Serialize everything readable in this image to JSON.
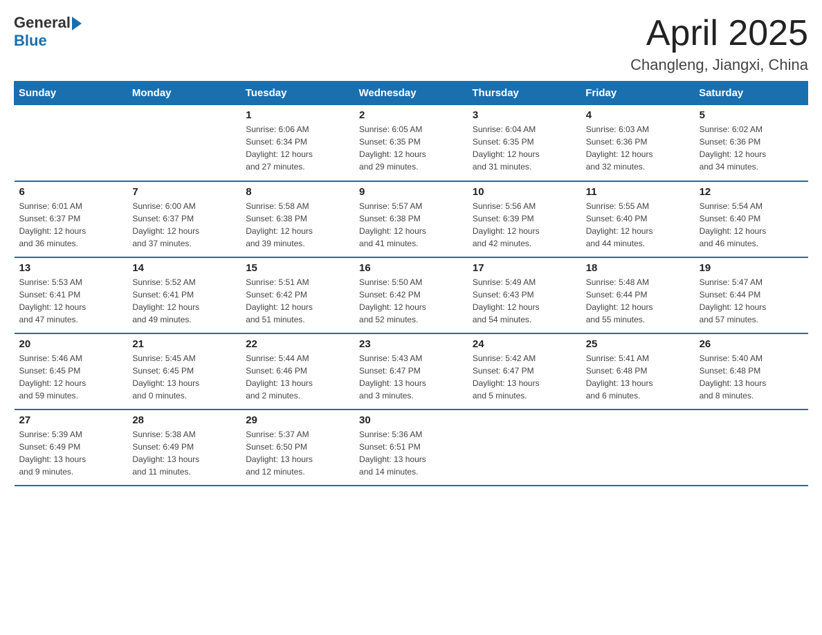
{
  "logo": {
    "text_general": "General",
    "text_blue": "Blue"
  },
  "header": {
    "month": "April 2025",
    "location": "Changleng, Jiangxi, China"
  },
  "weekdays": [
    "Sunday",
    "Monday",
    "Tuesday",
    "Wednesday",
    "Thursday",
    "Friday",
    "Saturday"
  ],
  "weeks": [
    [
      {
        "day": "",
        "info": ""
      },
      {
        "day": "",
        "info": ""
      },
      {
        "day": "1",
        "info": "Sunrise: 6:06 AM\nSunset: 6:34 PM\nDaylight: 12 hours\nand 27 minutes."
      },
      {
        "day": "2",
        "info": "Sunrise: 6:05 AM\nSunset: 6:35 PM\nDaylight: 12 hours\nand 29 minutes."
      },
      {
        "day": "3",
        "info": "Sunrise: 6:04 AM\nSunset: 6:35 PM\nDaylight: 12 hours\nand 31 minutes."
      },
      {
        "day": "4",
        "info": "Sunrise: 6:03 AM\nSunset: 6:36 PM\nDaylight: 12 hours\nand 32 minutes."
      },
      {
        "day": "5",
        "info": "Sunrise: 6:02 AM\nSunset: 6:36 PM\nDaylight: 12 hours\nand 34 minutes."
      }
    ],
    [
      {
        "day": "6",
        "info": "Sunrise: 6:01 AM\nSunset: 6:37 PM\nDaylight: 12 hours\nand 36 minutes."
      },
      {
        "day": "7",
        "info": "Sunrise: 6:00 AM\nSunset: 6:37 PM\nDaylight: 12 hours\nand 37 minutes."
      },
      {
        "day": "8",
        "info": "Sunrise: 5:58 AM\nSunset: 6:38 PM\nDaylight: 12 hours\nand 39 minutes."
      },
      {
        "day": "9",
        "info": "Sunrise: 5:57 AM\nSunset: 6:38 PM\nDaylight: 12 hours\nand 41 minutes."
      },
      {
        "day": "10",
        "info": "Sunrise: 5:56 AM\nSunset: 6:39 PM\nDaylight: 12 hours\nand 42 minutes."
      },
      {
        "day": "11",
        "info": "Sunrise: 5:55 AM\nSunset: 6:40 PM\nDaylight: 12 hours\nand 44 minutes."
      },
      {
        "day": "12",
        "info": "Sunrise: 5:54 AM\nSunset: 6:40 PM\nDaylight: 12 hours\nand 46 minutes."
      }
    ],
    [
      {
        "day": "13",
        "info": "Sunrise: 5:53 AM\nSunset: 6:41 PM\nDaylight: 12 hours\nand 47 minutes."
      },
      {
        "day": "14",
        "info": "Sunrise: 5:52 AM\nSunset: 6:41 PM\nDaylight: 12 hours\nand 49 minutes."
      },
      {
        "day": "15",
        "info": "Sunrise: 5:51 AM\nSunset: 6:42 PM\nDaylight: 12 hours\nand 51 minutes."
      },
      {
        "day": "16",
        "info": "Sunrise: 5:50 AM\nSunset: 6:42 PM\nDaylight: 12 hours\nand 52 minutes."
      },
      {
        "day": "17",
        "info": "Sunrise: 5:49 AM\nSunset: 6:43 PM\nDaylight: 12 hours\nand 54 minutes."
      },
      {
        "day": "18",
        "info": "Sunrise: 5:48 AM\nSunset: 6:44 PM\nDaylight: 12 hours\nand 55 minutes."
      },
      {
        "day": "19",
        "info": "Sunrise: 5:47 AM\nSunset: 6:44 PM\nDaylight: 12 hours\nand 57 minutes."
      }
    ],
    [
      {
        "day": "20",
        "info": "Sunrise: 5:46 AM\nSunset: 6:45 PM\nDaylight: 12 hours\nand 59 minutes."
      },
      {
        "day": "21",
        "info": "Sunrise: 5:45 AM\nSunset: 6:45 PM\nDaylight: 13 hours\nand 0 minutes."
      },
      {
        "day": "22",
        "info": "Sunrise: 5:44 AM\nSunset: 6:46 PM\nDaylight: 13 hours\nand 2 minutes."
      },
      {
        "day": "23",
        "info": "Sunrise: 5:43 AM\nSunset: 6:47 PM\nDaylight: 13 hours\nand 3 minutes."
      },
      {
        "day": "24",
        "info": "Sunrise: 5:42 AM\nSunset: 6:47 PM\nDaylight: 13 hours\nand 5 minutes."
      },
      {
        "day": "25",
        "info": "Sunrise: 5:41 AM\nSunset: 6:48 PM\nDaylight: 13 hours\nand 6 minutes."
      },
      {
        "day": "26",
        "info": "Sunrise: 5:40 AM\nSunset: 6:48 PM\nDaylight: 13 hours\nand 8 minutes."
      }
    ],
    [
      {
        "day": "27",
        "info": "Sunrise: 5:39 AM\nSunset: 6:49 PM\nDaylight: 13 hours\nand 9 minutes."
      },
      {
        "day": "28",
        "info": "Sunrise: 5:38 AM\nSunset: 6:49 PM\nDaylight: 13 hours\nand 11 minutes."
      },
      {
        "day": "29",
        "info": "Sunrise: 5:37 AM\nSunset: 6:50 PM\nDaylight: 13 hours\nand 12 minutes."
      },
      {
        "day": "30",
        "info": "Sunrise: 5:36 AM\nSunset: 6:51 PM\nDaylight: 13 hours\nand 14 minutes."
      },
      {
        "day": "",
        "info": ""
      },
      {
        "day": "",
        "info": ""
      },
      {
        "day": "",
        "info": ""
      }
    ]
  ]
}
